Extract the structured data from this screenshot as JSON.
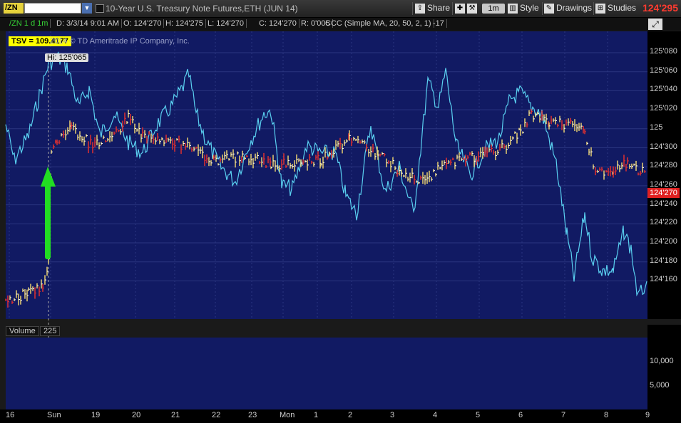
{
  "toolbar": {
    "symbol": "/ZN",
    "title": "10-Year U.S. Treasury Note Futures,ETH (JUN 14)",
    "share_label": "Share",
    "timeframe": "1m",
    "style_label": "Style",
    "drawings_label": "Drawings",
    "studies_label": "Studies",
    "last_price": "124'295"
  },
  "info_bar": {
    "instrument": "/ZN 1 d 1m",
    "date": "D: 3/3/14 9:01 AM",
    "open": "O: 124'270",
    "high": "H: 124'275",
    "low": "L: 124'270",
    "close": "C: 124'270",
    "range": "R: 0'005",
    "study": "CCC (Simple MA, 20, 50, 2, 1)",
    "study_value": "-17"
  },
  "chart_labels": {
    "tsv": "TSV  = 109.4177",
    "copyright": "2014 © TD Ameritrade IP Company, Inc.",
    "hi_label": "Hi: 125'065",
    "current_price_tag": "124'270"
  },
  "price_axis": [
    "125'080",
    "125'060",
    "125'040",
    "125'020",
    "125",
    "124'300",
    "124'280",
    "124'260",
    "124'240",
    "124'220",
    "124'200",
    "124'180",
    "124'160"
  ],
  "volume": {
    "label": "Volume",
    "value": "225",
    "axis": [
      "10,000",
      "5,000"
    ]
  },
  "x_axis": [
    "16",
    "Sun",
    "19",
    "20",
    "21",
    "22",
    "23",
    "Mon",
    "1",
    "2",
    "3",
    "4",
    "5",
    "6",
    "7",
    "8",
    "9"
  ],
  "colors": {
    "chart_bg": "#111a63",
    "tsv_line": "#5ad0f0",
    "up_bar": "#e8d070",
    "down_bar": "#e03030",
    "arrow": "#22dd22",
    "volume_bar": "#3a5ad8"
  }
}
